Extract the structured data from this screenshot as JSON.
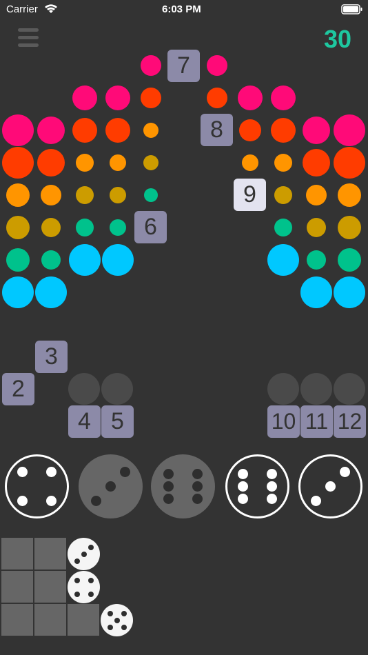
{
  "status": {
    "carrier": "Carrier",
    "time": "6:03 PM"
  },
  "score": "30",
  "colors": {
    "magenta": "#ff0a78",
    "red": "#ff3c00",
    "orange": "#ff9500",
    "mustard": "#cc9c00",
    "green": "#00c28c",
    "cyan": "#00c8ff",
    "score": "#1ec8a0",
    "tile": "#8c8aa8",
    "tile_highlight": "#e3e3f0"
  },
  "tiles": {
    "t2": "2",
    "t3": "3",
    "t4": "4",
    "t5": "5",
    "t6": "6",
    "t7": "7",
    "t8": "8",
    "t9": "9",
    "t10": "10",
    "t11": "11",
    "t12": "12"
  },
  "dice": {
    "d1": {
      "value": 4,
      "state": "selected"
    },
    "d2": {
      "value": 3,
      "state": "unselected"
    },
    "d3": {
      "value": 6,
      "state": "unselected"
    },
    "d4": {
      "value": 6,
      "state": "selected"
    },
    "d5": {
      "value": 3,
      "state": "selected"
    }
  },
  "history_dice": [
    3,
    4,
    5
  ]
}
